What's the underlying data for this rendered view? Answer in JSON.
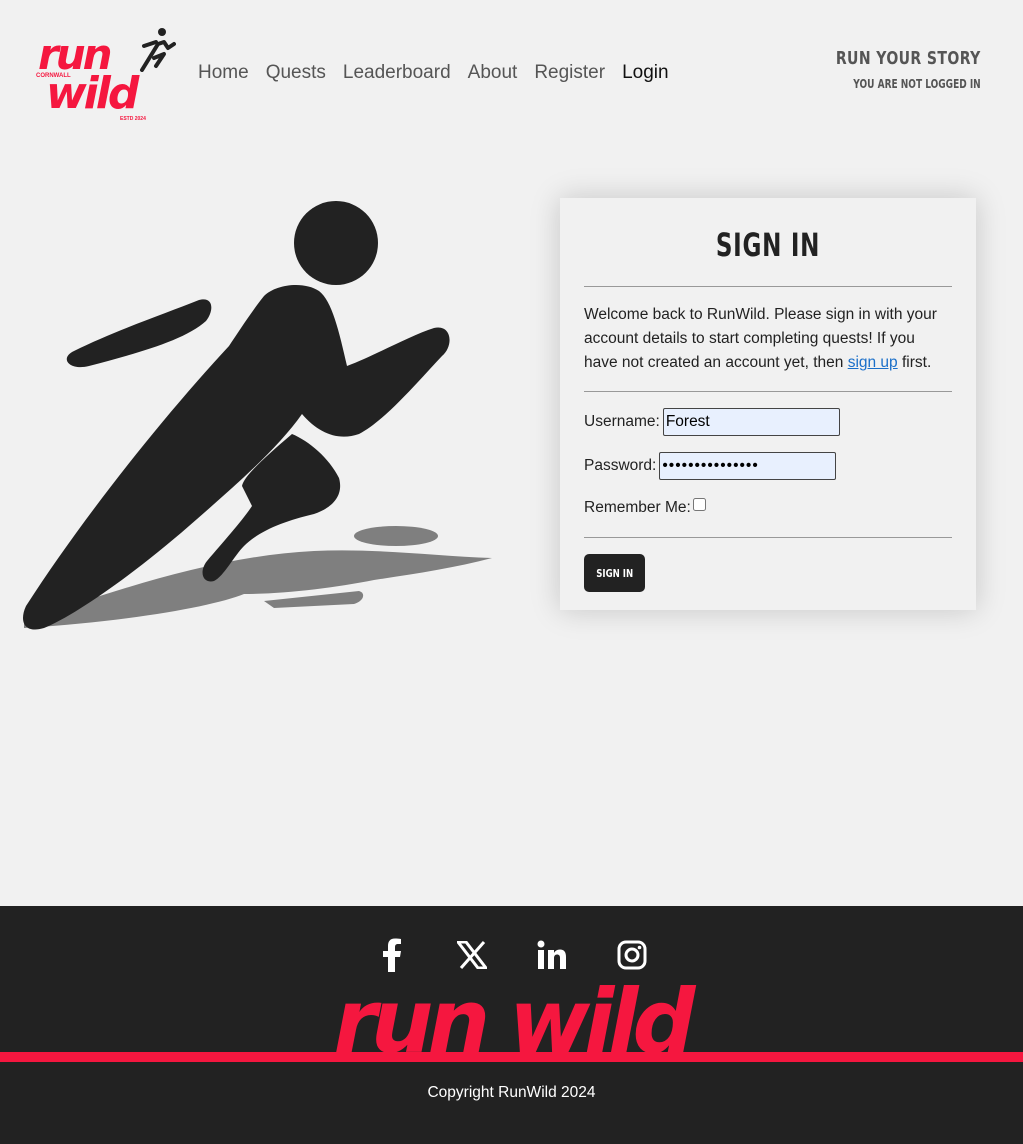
{
  "brand": {
    "logo_top": "run",
    "logo_bottom": "wild",
    "logo_side": "CORNWALL",
    "logo_est": "ESTD 2024",
    "accent_color": "#f5173f"
  },
  "nav": {
    "items": [
      {
        "label": "Home"
      },
      {
        "label": "Quests"
      },
      {
        "label": "Leaderboard"
      },
      {
        "label": "About"
      },
      {
        "label": "Register"
      },
      {
        "label": "Login",
        "active": true
      }
    ]
  },
  "tagline": {
    "title": "RUN YOUR STORY",
    "status": "YOU ARE NOT LOGGED IN"
  },
  "signin": {
    "heading": "SIGN IN",
    "intro_before": "Welcome back to RunWild. Please sign in with your account details to start completing quests! If you have not created an account yet, then ",
    "intro_link": "sign up",
    "intro_after": " first.",
    "username_label": "Username:",
    "username_value": "Forest",
    "password_label": "Password:",
    "password_value": "•••••••••••••••",
    "remember_label": "Remember Me:",
    "remember_checked": false,
    "button_label": "SIGN IN"
  },
  "footer": {
    "social_icons": [
      "facebook-icon",
      "x-icon",
      "linkedin-icon",
      "instagram-icon"
    ],
    "brand_text": "run wild",
    "copyright": "Copyright RunWild 2024"
  }
}
